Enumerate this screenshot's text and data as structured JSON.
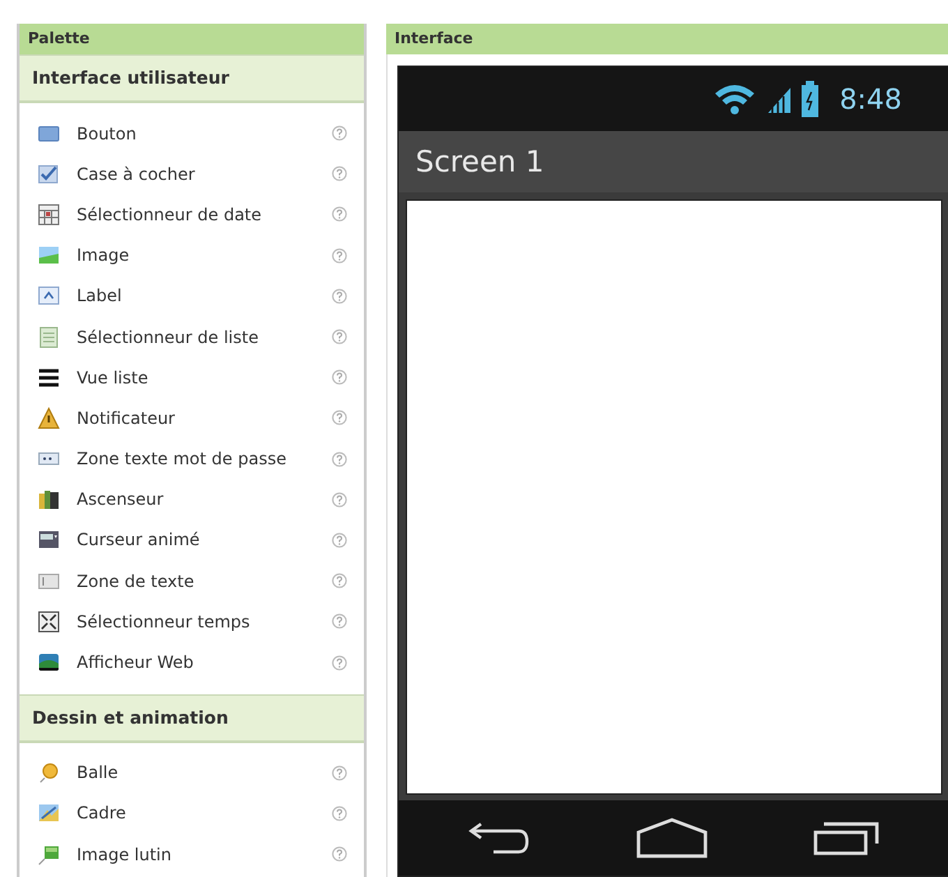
{
  "palette": {
    "title": "Palette",
    "sections": [
      {
        "title": "Interface utilisateur",
        "items": [
          {
            "label": "Bouton",
            "kind": "button"
          },
          {
            "label": "Case à cocher",
            "kind": "checkbox"
          },
          {
            "label": "Sélectionneur de date",
            "kind": "datepicker"
          },
          {
            "label": "Image",
            "kind": "image"
          },
          {
            "label": "Label",
            "kind": "label"
          },
          {
            "label": "Sélectionneur de liste",
            "kind": "listpicker"
          },
          {
            "label": "Vue liste",
            "kind": "listview"
          },
          {
            "label": "Notificateur",
            "kind": "notifier"
          },
          {
            "label": "Zone texte mot de passe",
            "kind": "password"
          },
          {
            "label": "Ascenseur",
            "kind": "slider"
          },
          {
            "label": "Curseur animé",
            "kind": "spinner"
          },
          {
            "label": "Zone de texte",
            "kind": "textbox"
          },
          {
            "label": "Sélectionneur temps",
            "kind": "timepicker"
          },
          {
            "label": "Afficheur Web",
            "kind": "webviewer"
          }
        ]
      },
      {
        "title": "Dessin et animation",
        "items": [
          {
            "label": "Balle",
            "kind": "ball"
          },
          {
            "label": "Cadre",
            "kind": "canvas"
          },
          {
            "label": "Image lutin",
            "kind": "sprite"
          }
        ]
      }
    ]
  },
  "viewer": {
    "title": "Interface",
    "phone": {
      "time": "8:48",
      "screen_title": "Screen 1"
    }
  }
}
